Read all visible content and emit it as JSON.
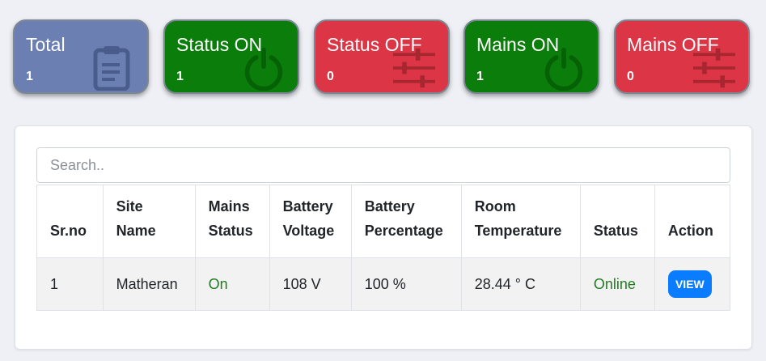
{
  "cards": [
    {
      "title": "Total",
      "count": "1",
      "icon": "clipboard-icon",
      "color": "#6c7fb3"
    },
    {
      "title": "Status ON",
      "count": "1",
      "icon": "power-icon",
      "color": "#0a7d0a"
    },
    {
      "title": "Status OFF",
      "count": "0",
      "icon": "sliders-icon",
      "color": "#dc3545"
    },
    {
      "title": "Mains ON",
      "count": "1",
      "icon": "power-icon",
      "color": "#0a7d0a"
    },
    {
      "title": "Mains OFF",
      "count": "0",
      "icon": "sliders-icon",
      "color": "#dc3545"
    }
  ],
  "search": {
    "placeholder": "Search..",
    "value": ""
  },
  "table": {
    "headers": [
      "Sr.no",
      "Site Name",
      "Mains Status",
      "Battery Voltage",
      "Battery Percentage",
      "Room Temperature",
      "Status",
      "Action"
    ],
    "rows": [
      {
        "sr": "1",
        "site": "Matheran",
        "mains": "On",
        "voltage": "108 V",
        "percentage": "100 %",
        "temperature": "28.44 ° C",
        "status": "Online",
        "action": "VIEW"
      }
    ]
  },
  "colors": {
    "accent": "#0a7cff",
    "online": "#1f7d1f"
  }
}
